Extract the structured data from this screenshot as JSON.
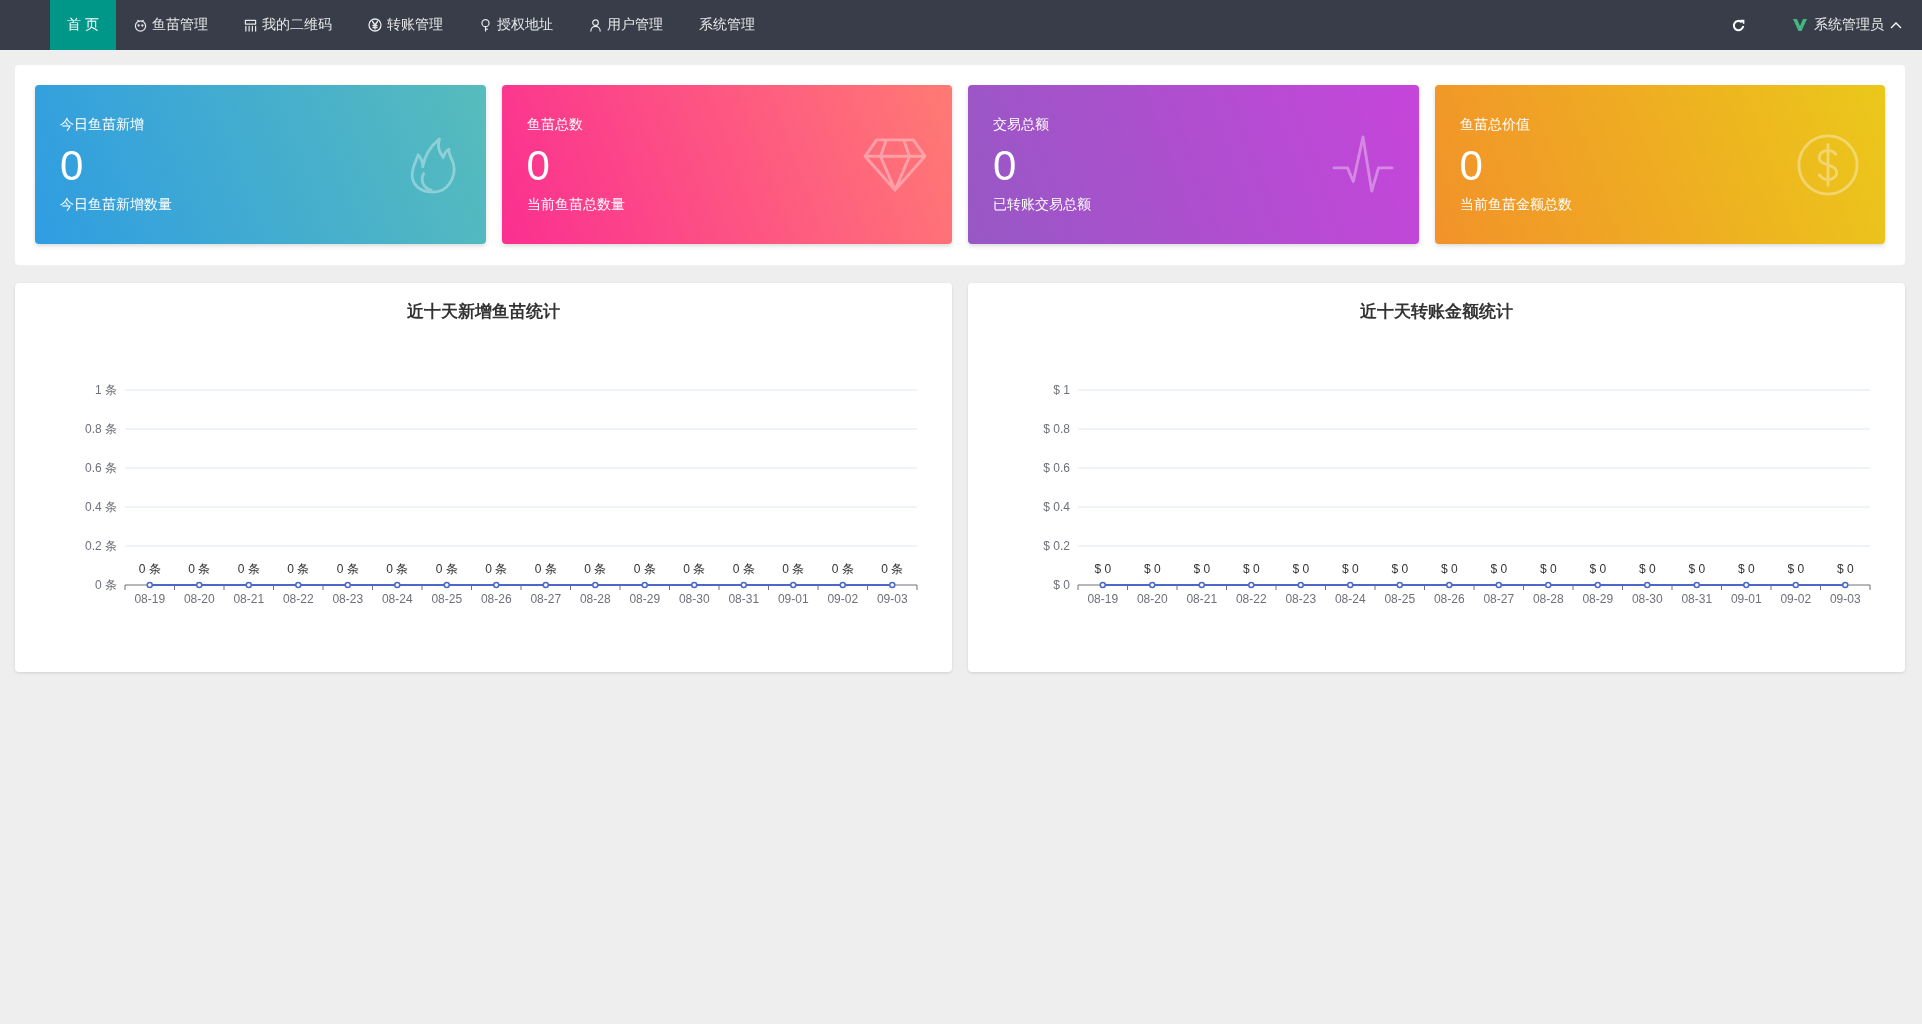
{
  "nav": {
    "items": [
      {
        "label": "首 页",
        "selected": true
      },
      {
        "label": "鱼苗管理",
        "selected": false
      },
      {
        "label": "我的二维码",
        "selected": false
      },
      {
        "label": "转账管理",
        "selected": false
      },
      {
        "label": "授权地址",
        "selected": false
      },
      {
        "label": "用户管理",
        "selected": false
      },
      {
        "label": "系统管理",
        "selected": false
      }
    ],
    "user": {
      "name": "系统管理员",
      "expanded": true
    }
  },
  "stats": [
    {
      "title": "今日鱼苗新增",
      "value": "0",
      "caption": "今日鱼苗新增数量"
    },
    {
      "title": "鱼苗总数",
      "value": "0",
      "caption": "当前鱼苗总数量"
    },
    {
      "title": "交易总额",
      "value": "0",
      "caption": "已转账交易总额"
    },
    {
      "title": "鱼苗总价值",
      "value": "0",
      "caption": "当前鱼苗金额总数"
    }
  ],
  "charts": [
    {
      "title": "近十天新增鱼苗统计",
      "chart_data": {
        "type": "line",
        "categories": [
          "08-19",
          "08-20",
          "08-21",
          "08-22",
          "08-23",
          "08-24",
          "08-25",
          "08-26",
          "08-27",
          "08-28",
          "08-29",
          "08-30",
          "08-31",
          "09-01",
          "09-02",
          "09-03"
        ],
        "series": [
          {
            "color": "#4b68c8",
            "marker": true,
            "values": [
              0,
              0,
              0,
              0,
              0,
              0,
              0,
              0,
              0,
              0,
              0,
              0,
              0,
              0,
              0,
              0
            ]
          }
        ],
        "grid": true,
        "ylim": [
          0,
          1
        ],
        "yticks": [
          {
            "value": 0,
            "label": "0 条"
          },
          {
            "value": 0.2,
            "label": "0.2 条"
          },
          {
            "value": 0.4,
            "label": "0.4 条"
          },
          {
            "value": 0.6,
            "label": "0.6 条"
          },
          {
            "value": 0.8,
            "label": "0.8 条"
          },
          {
            "value": 1,
            "label": "1 条"
          }
        ],
        "value_labels": [
          "0 条",
          "0 条",
          "0 条",
          "0 条",
          "0 条",
          "0 条",
          "0 条",
          "0 条",
          "0 条",
          "0 条",
          "0 条",
          "0 条",
          "0 条",
          "0 条",
          "0 条",
          "0 条"
        ]
      }
    },
    {
      "title": "近十天转账金额统计",
      "chart_data": {
        "type": "line",
        "categories": [
          "08-19",
          "08-20",
          "08-21",
          "08-22",
          "08-23",
          "08-24",
          "08-25",
          "08-26",
          "08-27",
          "08-28",
          "08-29",
          "08-30",
          "08-31",
          "09-01",
          "09-02",
          "09-03"
        ],
        "series": [
          {
            "color": "#4b68c8",
            "marker": true,
            "values": [
              0,
              0,
              0,
              0,
              0,
              0,
              0,
              0,
              0,
              0,
              0,
              0,
              0,
              0,
              0,
              0
            ]
          }
        ],
        "grid": true,
        "ylim": [
          0,
          1
        ],
        "yticks": [
          {
            "value": 0,
            "label": "$ 0"
          },
          {
            "value": 0.2,
            "label": "$ 0.2"
          },
          {
            "value": 0.4,
            "label": "$ 0.4"
          },
          {
            "value": 0.6,
            "label": "$ 0.6"
          },
          {
            "value": 0.8,
            "label": "$ 0.8"
          },
          {
            "value": 1,
            "label": "$ 1"
          }
        ],
        "value_labels": [
          "$ 0",
          "$ 0",
          "$ 0",
          "$ 0",
          "$ 0",
          "$ 0",
          "$ 0",
          "$ 0",
          "$ 0",
          "$ 0",
          "$ 0",
          "$ 0",
          "$ 0",
          "$ 0",
          "$ 0",
          "$ 0"
        ]
      }
    }
  ]
}
